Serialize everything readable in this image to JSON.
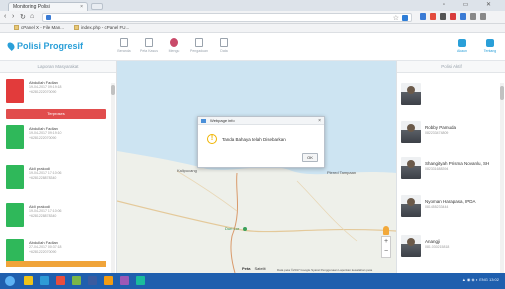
{
  "browser": {
    "tab_title": "Monitoring Polisi",
    "tab_close": "×",
    "window_controls": "▫ ▭ ✕",
    "nav_icons": [
      "back-icon",
      "forward-icon",
      "reload-icon",
      "home-icon"
    ],
    "bookmarks": [
      "cPanel X - File Man...",
      "index.php - cPanel FU..."
    ]
  },
  "app": {
    "brand": "Polisi Progresif",
    "nav": [
      {
        "label": "Beranda",
        "icon": "home-icon"
      },
      {
        "label": "Peta Kasus",
        "icon": "document-icon"
      },
      {
        "label": "Mengu",
        "icon": "map-pin-icon"
      },
      {
        "label": "Pengaduan",
        "icon": "file-icon"
      },
      {
        "label": "Data",
        "icon": "clipboard-icon"
      }
    ],
    "right_nav": [
      {
        "label": "Akaun",
        "icon": "user-icon"
      },
      {
        "label": "Tentang",
        "icon": "info-icon"
      }
    ],
    "accent": "#2a9fd8"
  },
  "left_panel": {
    "title": "Laporan Masyarakat",
    "reports": [
      {
        "name": "Abdullah Fadlan",
        "date": "19-04-2017 09:19:18",
        "phone": "+6281222070090",
        "status_color": "#e23b3b"
      },
      {
        "name": "Abdullah Fadlan",
        "date": "19-04-2017 09:19:10",
        "phone": "+6281222070090",
        "status_color": "#2fb85a"
      },
      {
        "name": "Aldi prakodi",
        "date": "19-04-2017 17:10:06",
        "phone": "+6281228878340",
        "status_color": "#2fb85a"
      },
      {
        "name": "Aldi prakodi",
        "date": "19-04-2017 17:10:06",
        "phone": "+6281228878340",
        "status_color": "#2fb85a"
      },
      {
        "name": "Abdullah Fadlan",
        "date": "27-04-2017 00:37:18",
        "phone": "+6281222070090",
        "status_color": "#2fb85a"
      }
    ],
    "action_button": "Terproses"
  },
  "map": {
    "labels": [
      "Plered Tampaan",
      "Duri Lor",
      "Kalipucang"
    ],
    "map_type": [
      "Peta",
      "Satelit"
    ],
    "attribution": "Data peta ©2017 Google  Syarat Penggunaan  Laporkan kesalahan peta",
    "zoom_in": "+",
    "zoom_out": "−",
    "dialog": {
      "title": "Webpage info",
      "close": "×",
      "warning_symbol": "!",
      "message": "Tanda Bahaya telah Disebarkan",
      "ok_label": "OK"
    }
  },
  "right_panel": {
    "title": "Polisi Aktif",
    "officers": [
      {
        "name": "",
        "phone": ""
      },
      {
        "name": "Robby Pamuda",
        "phone": "082233474809"
      },
      {
        "name": "Shangityah Prisma Novanlu, SH",
        "phone": "082331688394"
      },
      {
        "name": "Nyoman Harapasa, IPDA",
        "phone": "081455233444"
      },
      {
        "name": "Anangji",
        "phone": "081.030215818"
      }
    ]
  },
  "taskbar": {
    "icon_colors": [
      "#f0c419",
      "#2e9bd6",
      "#e84d3d",
      "#7ab648",
      "#3a5ba0",
      "#f39c12",
      "#9b59b6",
      "#1abc9c"
    ],
    "tray_text": "▲ ◉ ◈ ◗ ENG  13:02"
  }
}
